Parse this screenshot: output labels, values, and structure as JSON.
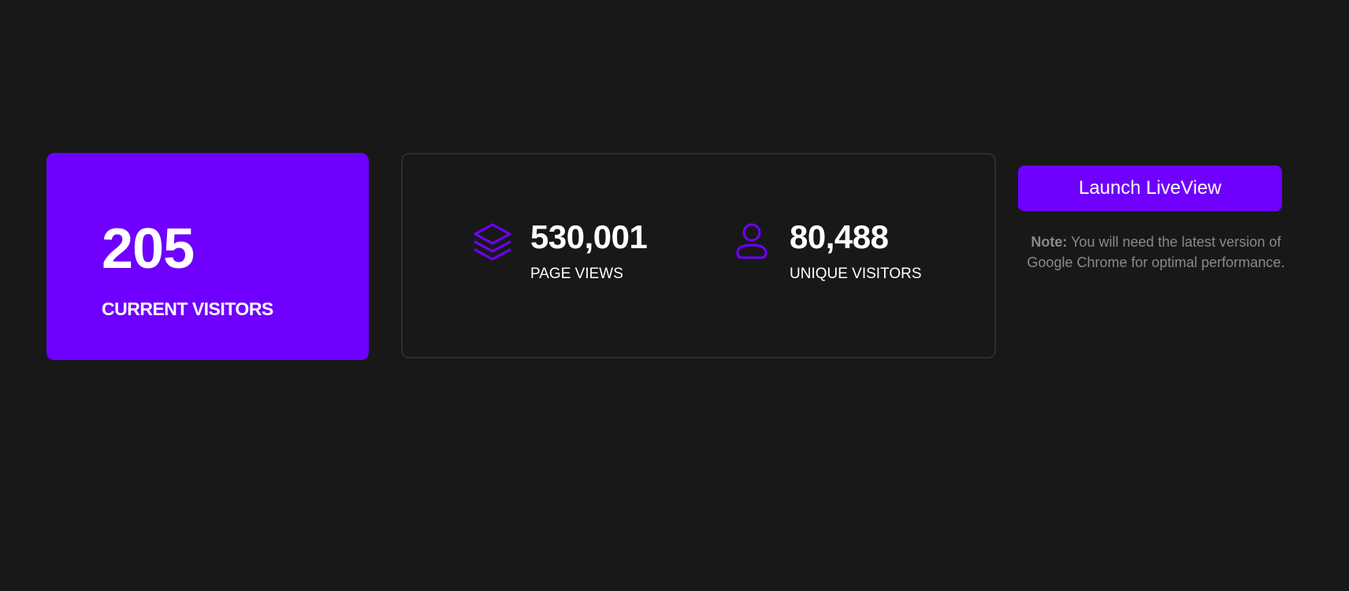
{
  "current_visitors": {
    "value": "205",
    "label": "CURRENT VISITORS"
  },
  "stats": {
    "page_views": {
      "value": "530,001",
      "label": "PAGE VIEWS",
      "icon": "layers-icon"
    },
    "unique_visitors": {
      "value": "80,488",
      "label": "UNIQUE VISITORS",
      "icon": "user-icon"
    }
  },
  "launch": {
    "label": "Launch LiveView",
    "note_prefix": "Note:",
    "note_text": " You will need the latest version of Google Chrome for optimal performance."
  },
  "colors": {
    "background": "#181818",
    "accent": "#6f00ff",
    "card_border": "#2d2d2d",
    "note_text": "#8a8a8a"
  }
}
